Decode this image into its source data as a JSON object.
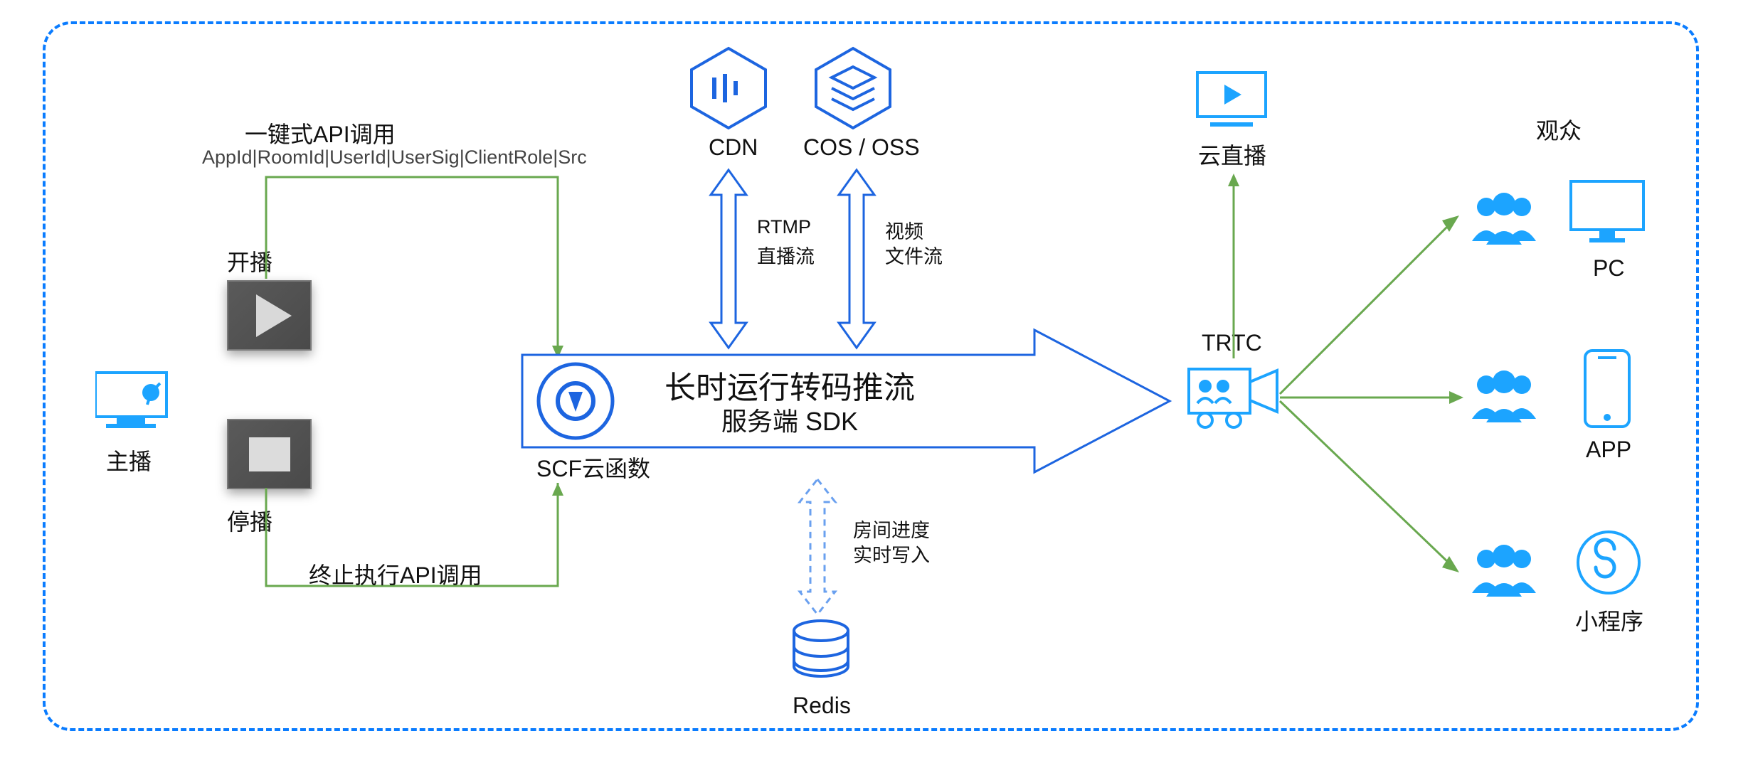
{
  "anchor": {
    "label": "主播",
    "play_label": "开播",
    "stop_label": "停播"
  },
  "api": {
    "call_label": "一键式API调用",
    "params": "AppId|RoomId|UserId|UserSig|ClientRole|Src",
    "terminate_label": "终止执行API调用"
  },
  "scf": {
    "label": "SCF云函数",
    "module_line1": "长时运行转码推流",
    "module_line2": "服务端 SDK"
  },
  "top_services": {
    "cdn": "CDN",
    "cos": "COS / OSS",
    "rtmp_line1": "RTMP",
    "rtmp_line2": "直播流",
    "video_line1": "视频",
    "video_line2": "文件流"
  },
  "redis": {
    "label": "Redis",
    "note_line1": "房间进度",
    "note_line2": "实时写入"
  },
  "live": {
    "label": "云直播"
  },
  "trtc": {
    "label": "TRTC"
  },
  "audience": {
    "title": "观众",
    "pc": "PC",
    "app": "APP",
    "mini": "小程序"
  },
  "colors": {
    "blue": "#0a7cff",
    "green": "#69a84f",
    "dashed": "#6aa0ef"
  }
}
